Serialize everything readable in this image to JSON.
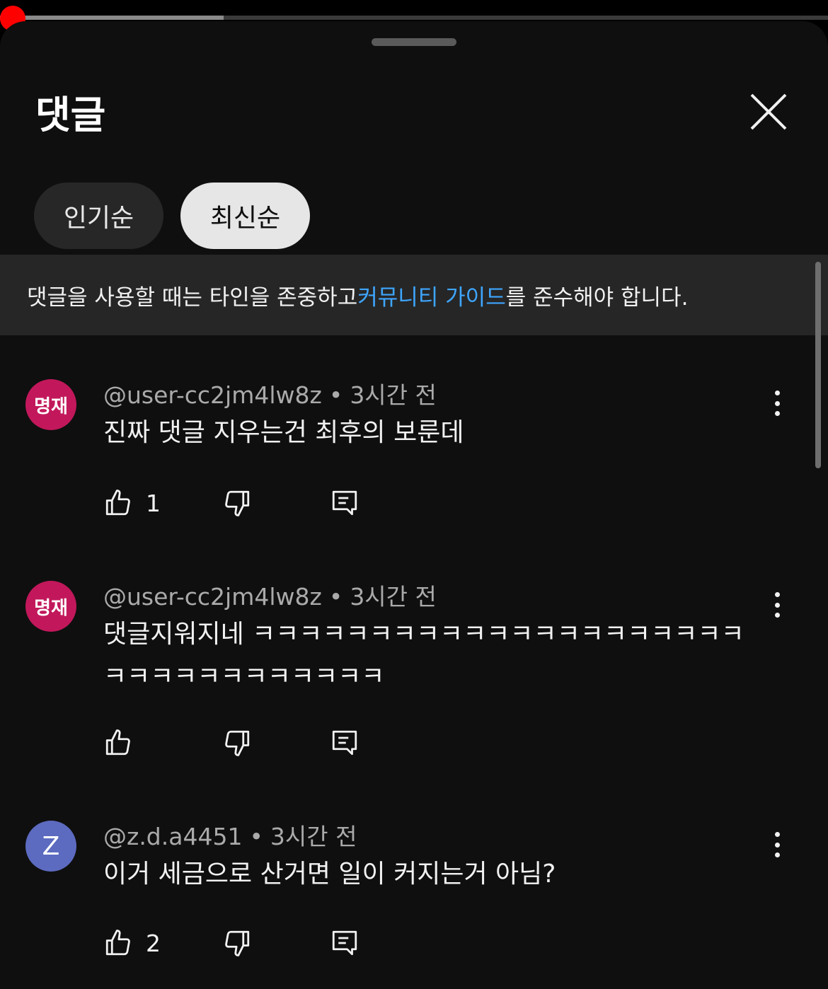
{
  "player": {
    "progress_fraction": 0.27
  },
  "sheet": {
    "title": "댓글",
    "close_icon": "close-icon",
    "sort_chips": [
      {
        "label": "인기순",
        "selected": false
      },
      {
        "label": "최신순",
        "selected": true
      }
    ],
    "guideline": {
      "prefix": "댓글을 사용할 때는 타인을 존중하고 ",
      "link": "커뮤니티 가이드",
      "suffix": "를 준수해야 합니다."
    }
  },
  "comments": [
    {
      "avatar_text": "명재",
      "avatar_color": "#c2185b",
      "author": "@user-cc2jm4lw8z",
      "time": "3시간 전",
      "text": "진짜 댓글 지우는건 최후의 보룬데",
      "likes": "1"
    },
    {
      "avatar_text": "명재",
      "avatar_color": "#c2185b",
      "author": "@user-cc2jm4lw8z",
      "time": "3시간 전",
      "text": "댓글지워지네 ㅋㅋㅋㅋㅋㅋㅋㅋㅋㅋㅋㅋㅋㅋㅋㅋㅋㅋㅋㅋㅋㅋㅋㅋㅋㅋㅋㅋㅋㅋㅋㅋㅋ",
      "likes": ""
    },
    {
      "avatar_text": "Z",
      "avatar_color": "#5c6bc0",
      "author": "@z.d.a4451",
      "time": "3시간 전",
      "text": "이거 세금으로 산거면 일이 커지는거 아님?",
      "likes": "2"
    }
  ],
  "colors": {
    "accent_link": "#3ea6ff",
    "progress_dot": "#ff0000",
    "sheet_bg": "#0f0f0f"
  }
}
